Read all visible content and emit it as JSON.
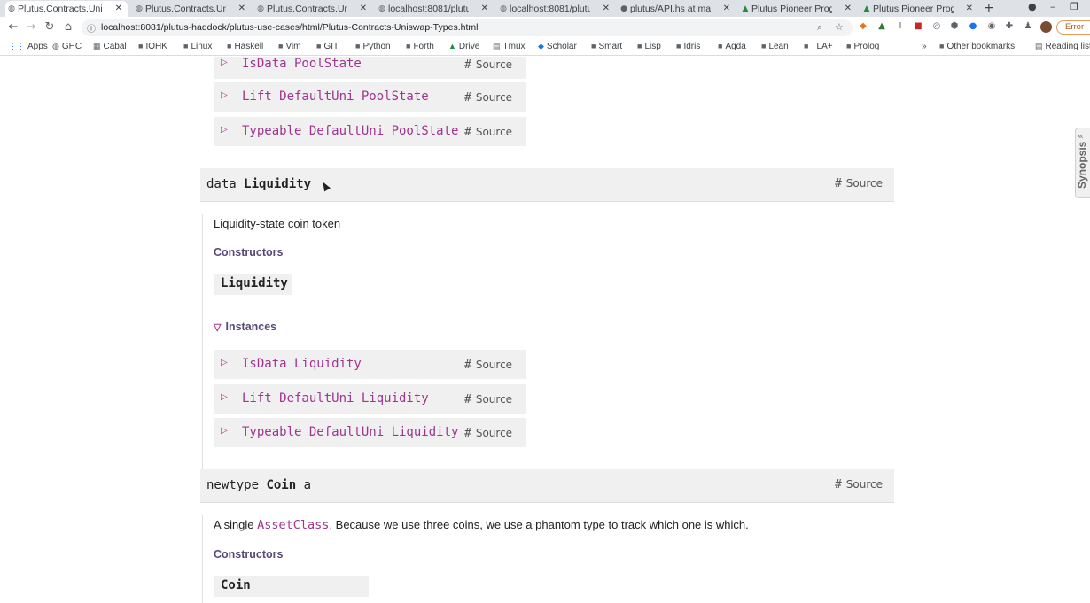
{
  "tabs": [
    {
      "title": "Plutus.Contracts.Unis",
      "icon": "globe-icon",
      "active": true
    },
    {
      "title": "Plutus.Contracts.Unis",
      "icon": "globe-icon"
    },
    {
      "title": "Plutus.Contracts.Unis",
      "icon": "globe-icon"
    },
    {
      "title": "localhost:8081/plutu",
      "icon": "globe-icon"
    },
    {
      "title": "localhost:8081/plutu",
      "icon": "globe-icon"
    },
    {
      "title": "plutus/API.hs at mas",
      "icon": "github-icon"
    },
    {
      "title": "Plutus Pioneer Progr",
      "icon": "drive-icon"
    },
    {
      "title": "Plutus Pioneer Progr",
      "icon": "drive-icon"
    }
  ],
  "address_bar": {
    "url": "localhost:8081/plutus-haddock/plutus-use-cases/html/Plutus-Contracts-Uniswap-Types.html"
  },
  "error_button": "Error",
  "bookmarks": [
    "Apps",
    "GHC",
    "Cabal",
    "IOHK",
    "Linux",
    "Haskell",
    "Vim",
    "GIT",
    "Python",
    "Forth",
    "Drive",
    "Tmux",
    "Scholar",
    "Smart",
    "Lisp",
    "Idris",
    "Agda",
    "Lean",
    "TLA+",
    "Prolog"
  ],
  "bookmarks_overflow": "»",
  "other_bookmarks": "Other bookmarks",
  "reading_list": "Reading list",
  "page": {
    "source_label": "Source",
    "hash": "#",
    "poolstate_instances": [
      "IsData PoolState",
      "Lift DefaultUni PoolState",
      "Typeable DefaultUni PoolState"
    ],
    "liquidity": {
      "keyword": "data",
      "name": "Liquidity",
      "doc": "Liquidity-state coin token",
      "constructors_heading": "Constructors",
      "constructor": "Liquidity",
      "instances_heading": "Instances",
      "instances": [
        "IsData Liquidity",
        "Lift DefaultUni Liquidity",
        "Typeable DefaultUni Liquidity"
      ]
    },
    "coin": {
      "keyword": "newtype",
      "name": "Coin",
      "param": "a",
      "doc_before": "A single ",
      "doc_link": "AssetClass",
      "doc_after": ". Because we use three coins, we use a phantom type to track which one is which.",
      "constructors_heading": "Constructors",
      "constructor": "Coin"
    },
    "synopsis": "Synopsis"
  }
}
